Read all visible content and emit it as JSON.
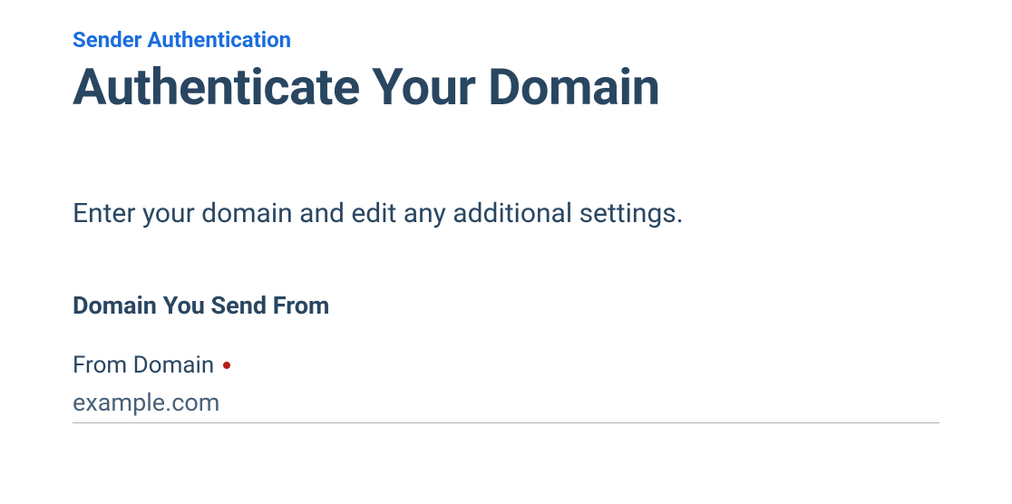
{
  "breadcrumb": {
    "link_text": "Sender Authentication"
  },
  "page": {
    "title": "Authenticate Your Domain",
    "description": "Enter your domain and edit any additional settings."
  },
  "form": {
    "section_heading": "Domain You Send From",
    "from_domain": {
      "label": "From Domain",
      "required": true,
      "placeholder": "example.com",
      "value": ""
    }
  },
  "colors": {
    "link_blue": "#1a6dde",
    "text_navy": "#294661",
    "required_red": "#b71c1c",
    "border_gray": "#b0b0b0"
  }
}
